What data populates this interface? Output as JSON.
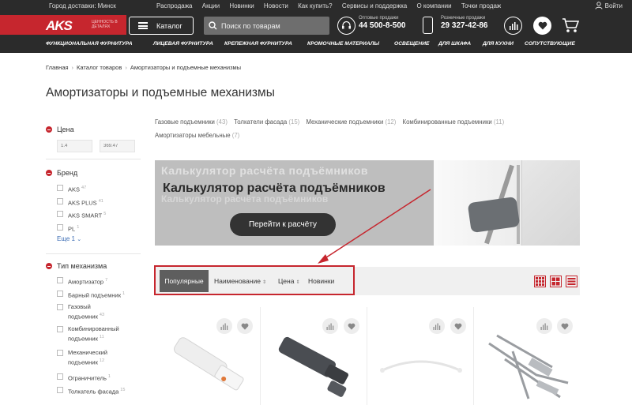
{
  "header": {
    "city": "Город доставки: Минск",
    "top_links": [
      "Распродажа",
      "Акции",
      "Новинки",
      "Новости",
      "Как купить?",
      "Сервисы и поддержка",
      "О компании",
      "Точки продаж"
    ],
    "login": "Войти",
    "logo": "AKS",
    "slogan": "ЦЕННОСТЬ В ДЕТАЛЯХ",
    "catalog_label": "Каталог",
    "search_placeholder": "Поиск по товарам",
    "wholesale_label": "Оптовые продажи",
    "wholesale_phone": "44 500-8-500",
    "retail_label": "Розничные продажи",
    "retail_phone": "29 327-42-86",
    "nav": [
      "ФУНКЦИОНАЛЬНАЯ ФУРНИТУРА",
      "ЛИЦЕВАЯ ФУРНИТУРА",
      "КРЕПЕЖНАЯ ФУРНИТУРА",
      "КРОМОЧНЫЕ МАТЕРИАЛЫ",
      "ОСВЕЩЕНИЕ",
      "ДЛЯ ШКАФА",
      "ДЛЯ КУХНИ",
      "СОПУТСТВУЮЩИЕ"
    ]
  },
  "breadcrumb": [
    "Главная",
    "Каталог товаров",
    "Амортизаторы и подъемные механизмы"
  ],
  "page_title": "Амортизаторы и подъемные механизмы",
  "sidebar": {
    "price": {
      "title": "Цена",
      "min": "1.4",
      "max": "369.47"
    },
    "brand": {
      "title": "Бренд",
      "items": [
        {
          "label": "AKS",
          "count": "47"
        },
        {
          "label": "AKS PLUS",
          "count": "41"
        },
        {
          "label": "AKS SMART",
          "count": "5"
        },
        {
          "label": "PL",
          "count": "1"
        }
      ],
      "more_label": "Еще",
      "more_count": "1"
    },
    "mechanism": {
      "title": "Тип механизма",
      "items": [
        {
          "line1": "Амортизатор",
          "line2": "",
          "count": "7"
        },
        {
          "line1": "Барный подъемник",
          "line2": "",
          "count": "1"
        },
        {
          "line1": "Газовый",
          "line2": "подъемник",
          "count": "43"
        },
        {
          "line1": "Комбинированный",
          "line2": "подъемник",
          "count": "11"
        },
        {
          "line1": "Механический",
          "line2": "подъемник",
          "count": "12"
        },
        {
          "line1": "Ограничитель",
          "line2": "",
          "count": "1"
        },
        {
          "line1": "Толкатель фасада",
          "line2": "",
          "count": "15"
        }
      ]
    }
  },
  "subcategories": [
    {
      "label": "Газовые подъемники",
      "count": "(43)"
    },
    {
      "label": "Толкатели фасада",
      "count": "(15)"
    },
    {
      "label": "Механические подъемники",
      "count": "(12)"
    },
    {
      "label": "Комбинированные подъемники",
      "count": "(11)"
    },
    {
      "label": "Амортизаторы мебельные",
      "count": "(7)"
    }
  ],
  "banner": {
    "title": "Калькулятор расчёта подъёмников",
    "button": "Перейти к расчёту"
  },
  "sort": {
    "active": "Популярные",
    "items": [
      "Наименование",
      "Цена",
      "Новинки"
    ]
  },
  "colors": {
    "brand_red": "#c6262e",
    "header_dark": "#2b2b2b",
    "link_blue": "#3b6cb4"
  }
}
